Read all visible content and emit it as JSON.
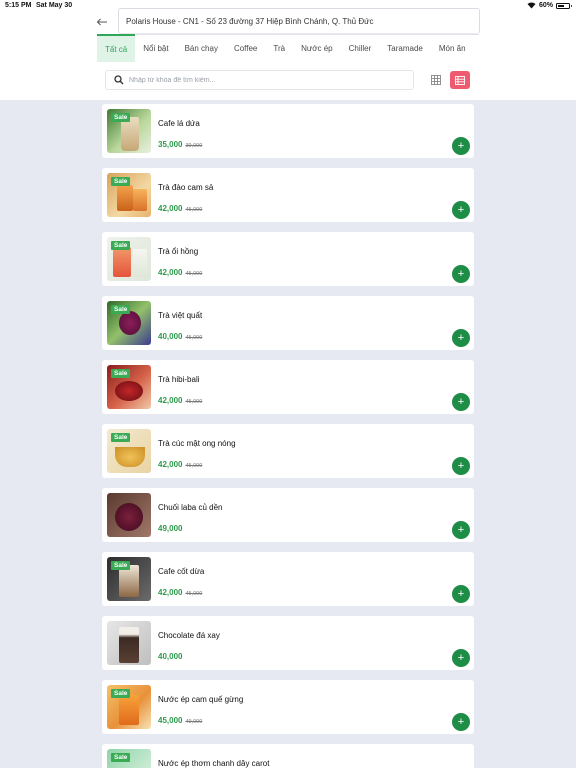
{
  "status_bar": {
    "time": "5:15 PM",
    "date": "Sat May 30",
    "battery": "60%",
    "battery_level": 0.6
  },
  "header": {
    "address": "Polaris House - CN1 - Số 23 đường 37 Hiệp Bình Chánh, Q. Thủ Đức"
  },
  "tabs": [
    {
      "label": "Tất cả",
      "active": true
    },
    {
      "label": "Nổi bật"
    },
    {
      "label": "Bán chạy"
    },
    {
      "label": "Coffee"
    },
    {
      "label": "Trà"
    },
    {
      "label": "Nước ép"
    },
    {
      "label": "Chiller"
    },
    {
      "label": "Taramade"
    },
    {
      "label": "Món ăn"
    }
  ],
  "search": {
    "placeholder": "Nhập từ khóa để tìm kiếm..."
  },
  "colors": {
    "accent": "#2fa65a",
    "price": "#2e9a4c",
    "add_button": "#1e8d45",
    "sale_badge": "#3aaa55",
    "list_view_active": "#ee5a6f"
  },
  "products": [
    {
      "name": "Cafe lá dứa",
      "price": "35,000",
      "old_price": "39,000",
      "sale": "Sale"
    },
    {
      "name": "Trà đào cam sả",
      "price": "42,000",
      "old_price": "45,000",
      "sale": "Sale"
    },
    {
      "name": "Trà ổi hồng",
      "price": "42,000",
      "old_price": "45,000",
      "sale": "Sale"
    },
    {
      "name": "Trà việt quất",
      "price": "40,000",
      "old_price": "45,000",
      "sale": "Sale"
    },
    {
      "name": "Trà hibi-bali",
      "price": "42,000",
      "old_price": "45,000",
      "sale": "Sale"
    },
    {
      "name": "Trà cúc mật ong nóng",
      "price": "42,000",
      "old_price": "45,000",
      "sale": "Sale"
    },
    {
      "name": "Chuối laba củ dền",
      "price": "49,000",
      "old_price": "",
      "sale": ""
    },
    {
      "name": "Cafe cốt dừa",
      "price": "42,000",
      "old_price": "45,000",
      "sale": "Sale"
    },
    {
      "name": "Chocolate đá xay",
      "price": "40,000",
      "old_price": "",
      "sale": ""
    },
    {
      "name": "Nước ép cam quế gừng",
      "price": "45,000",
      "old_price": "49,000",
      "sale": "Sale"
    },
    {
      "name": "Nước ép thơm chanh dây carot",
      "price": "",
      "old_price": "",
      "sale": "Sale"
    }
  ]
}
